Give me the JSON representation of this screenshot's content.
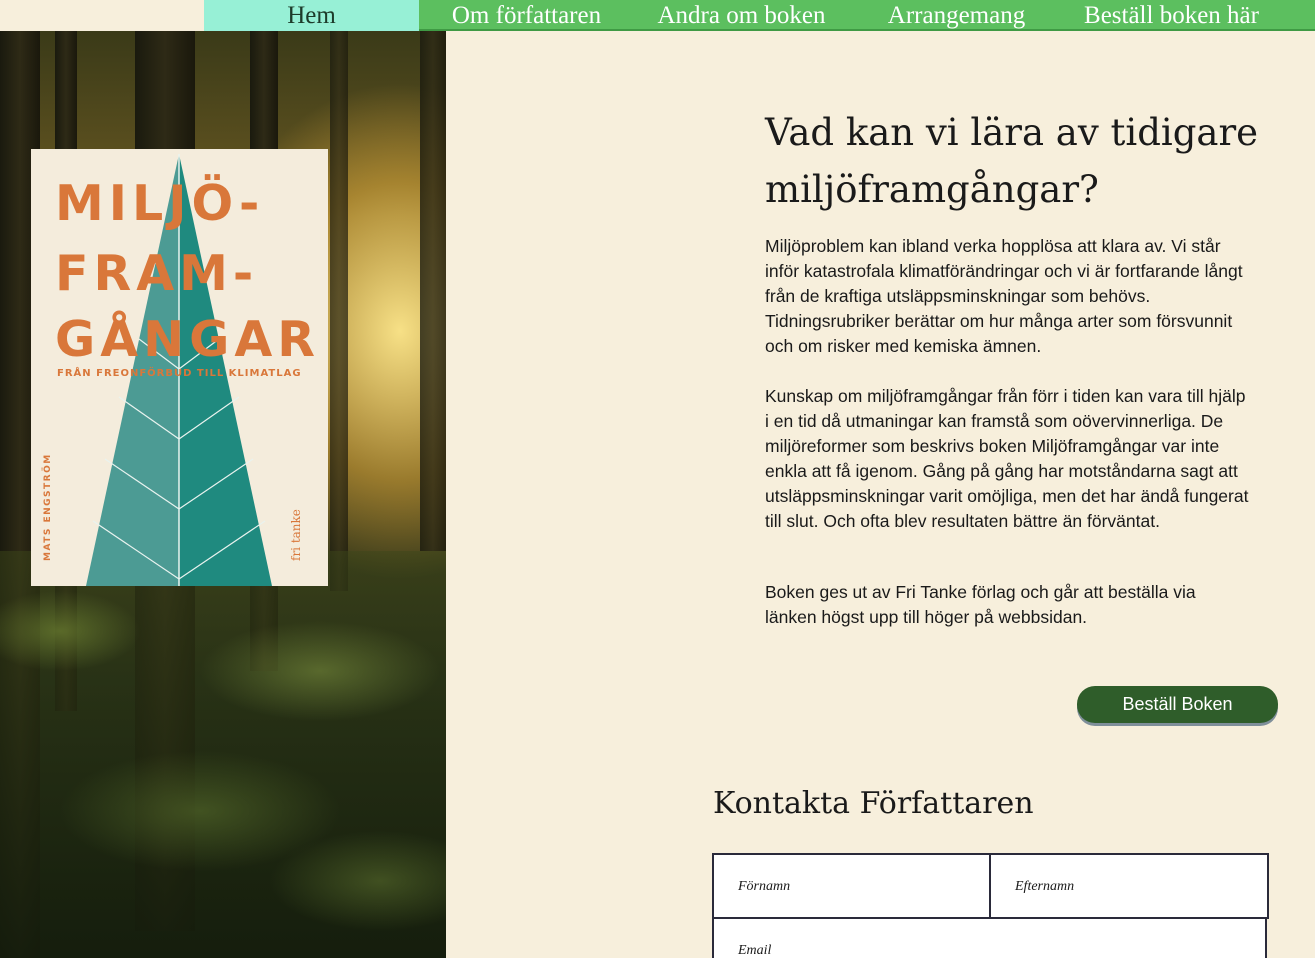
{
  "nav": {
    "items": [
      {
        "label": "Hem",
        "active": true
      },
      {
        "label": "Om författaren",
        "active": false
      },
      {
        "label": "Andra om boken",
        "active": false
      },
      {
        "label": "Arrangemang",
        "active": false
      },
      {
        "label": "Beställ boken här",
        "active": false
      }
    ]
  },
  "book_cover": {
    "title_lines": [
      "MILJÖ-",
      "FRAM-",
      "GÅNGAR"
    ],
    "subtitle": "FRÅN FREONFÖRBUD TILL KLIMATLAG",
    "author": "MATS ENGSTRÖM",
    "publisher": "fri tanke",
    "colors": {
      "title": "#d9773a",
      "tree_dark": "#1f8a7f",
      "tree_light": "#4c9b94",
      "background": "#f4ecdc"
    }
  },
  "main": {
    "headline": "Vad kan vi lära av tidigare miljöframgångar?",
    "paragraphs": [
      "Miljöproblem kan ibland verka hopplösa att klara av. Vi står inför katastrofala klimatförändringar och vi är fortfarande långt från de kraftiga utsläppsminskningar som behövs. Tidningsrubriker berättar om hur många arter som försvunnit och om risker med kemiska ämnen.",
      "Kunskap om miljöframgångar från förr i tiden kan vara till hjälp i en tid då utmaningar kan framstå som oövervinnerliga. De miljöreformer som beskrivs boken Miljöframgångar var inte enkla att få igenom. Gång på gång har motståndarna sagt att utsläppsminskningar varit omöjliga, men det har ändå fungerat till slut. Och ofta blev resultaten bättre än förväntat.",
      "Boken ges ut av Fri Tanke förlag och går att beställa via länken högst upp till höger på webbsidan."
    ],
    "order_button": "Beställ Boken"
  },
  "contact": {
    "title": "Kontakta Författaren",
    "fields": {
      "first_name": "Förnamn",
      "last_name": "Efternamn",
      "email": "Email"
    }
  },
  "colors": {
    "page_bg": "#f7efdc",
    "nav_bg": "#5cbf5f",
    "nav_active": "#97f0d6",
    "button_bg": "#2f5d2a"
  }
}
